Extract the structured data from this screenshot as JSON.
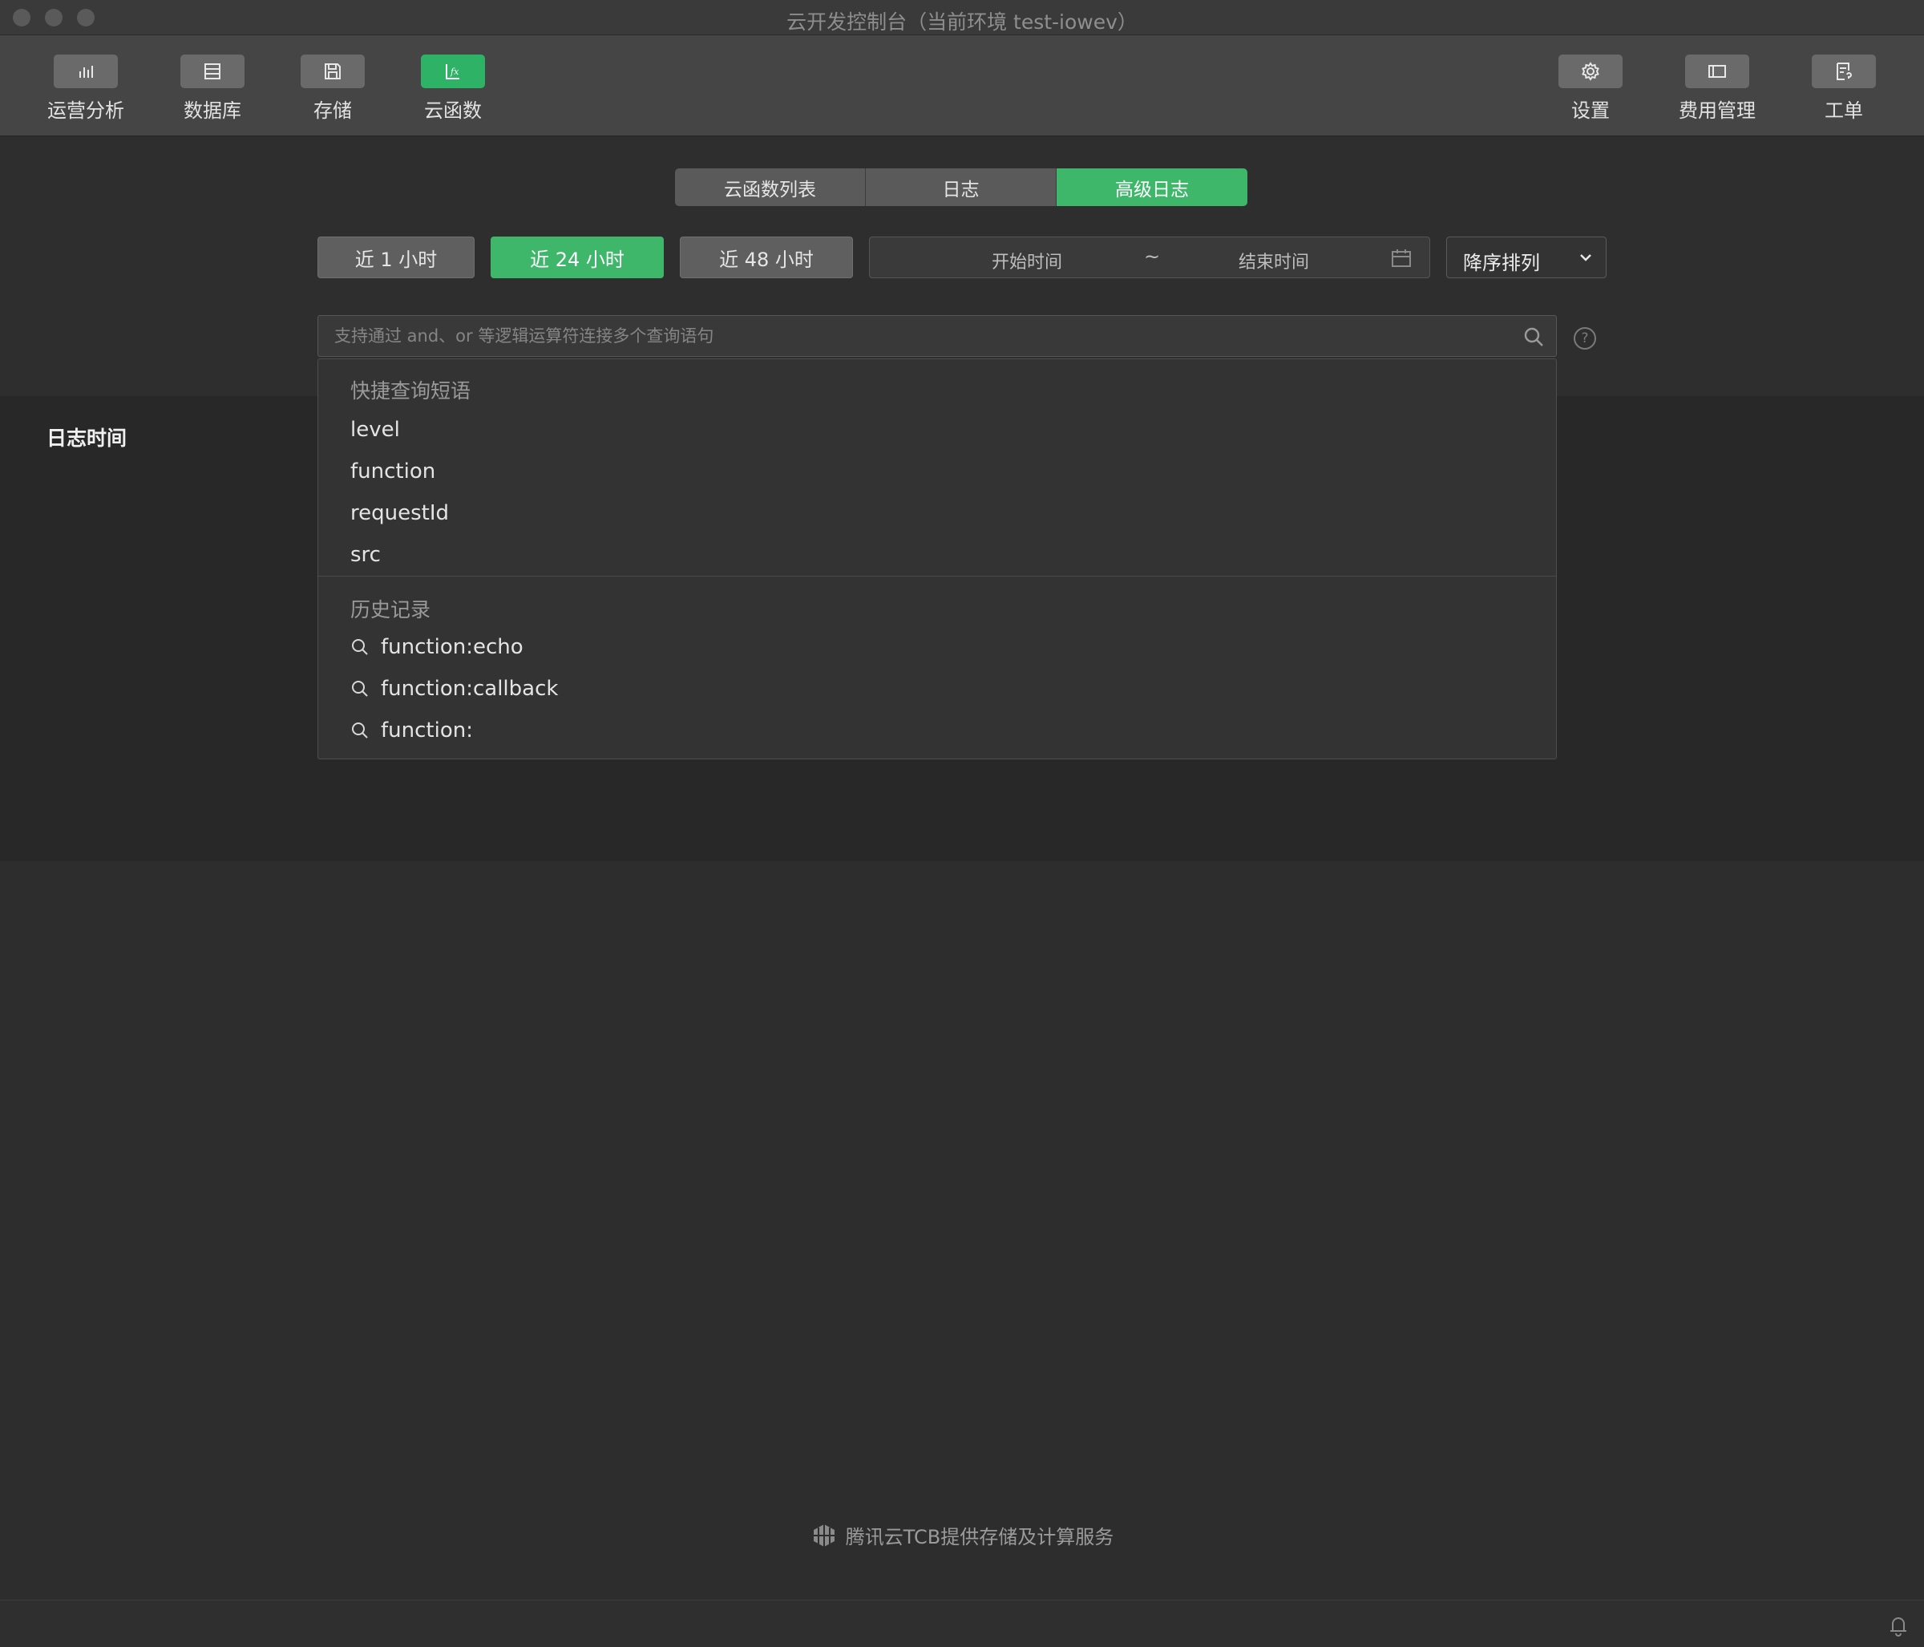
{
  "window": {
    "title": "云开发控制台（当前环境 test-iowev）"
  },
  "toolbar": {
    "left": [
      {
        "label": "运营分析",
        "icon": "bar-chart-icon"
      },
      {
        "label": "数据库",
        "icon": "database-icon"
      },
      {
        "label": "存储",
        "icon": "floppy-disk-icon"
      },
      {
        "label": "云函数",
        "icon": "function-fx-icon",
        "active": true
      }
    ],
    "right": [
      {
        "label": "设置",
        "icon": "gear-icon"
      },
      {
        "label": "费用管理",
        "icon": "wallet-icon"
      },
      {
        "label": "工单",
        "icon": "ticket-icon"
      }
    ]
  },
  "tabs": [
    {
      "label": "云函数列表"
    },
    {
      "label": "日志"
    },
    {
      "label": "高级日志",
      "active": true
    }
  ],
  "time_ranges": [
    {
      "label": "近 1 小时"
    },
    {
      "label": "近 24 小时",
      "active": true
    },
    {
      "label": "近 48 小时"
    }
  ],
  "date_range": {
    "start_placeholder": "开始时间",
    "separator": "~",
    "end_placeholder": "结束时间"
  },
  "sort": {
    "value": "降序排列"
  },
  "search": {
    "placeholder": "支持通过 and、or 等逻辑运算符连接多个查询语句",
    "value": "",
    "help": "?"
  },
  "log_time_header": "日志时间",
  "dropdown": {
    "quick_header": "快捷查询短语",
    "quick_items": [
      "level",
      "function",
      "requestId",
      "src"
    ],
    "history_header": "历史记录",
    "history_items": [
      "function:echo",
      "function:callback",
      "function:"
    ]
  },
  "footer": {
    "text": "腾讯云TCB提供存储及计算服务"
  },
  "colors": {
    "accent": "#3fb76a",
    "background": "#2d2d2d",
    "toolbar": "#454545"
  }
}
